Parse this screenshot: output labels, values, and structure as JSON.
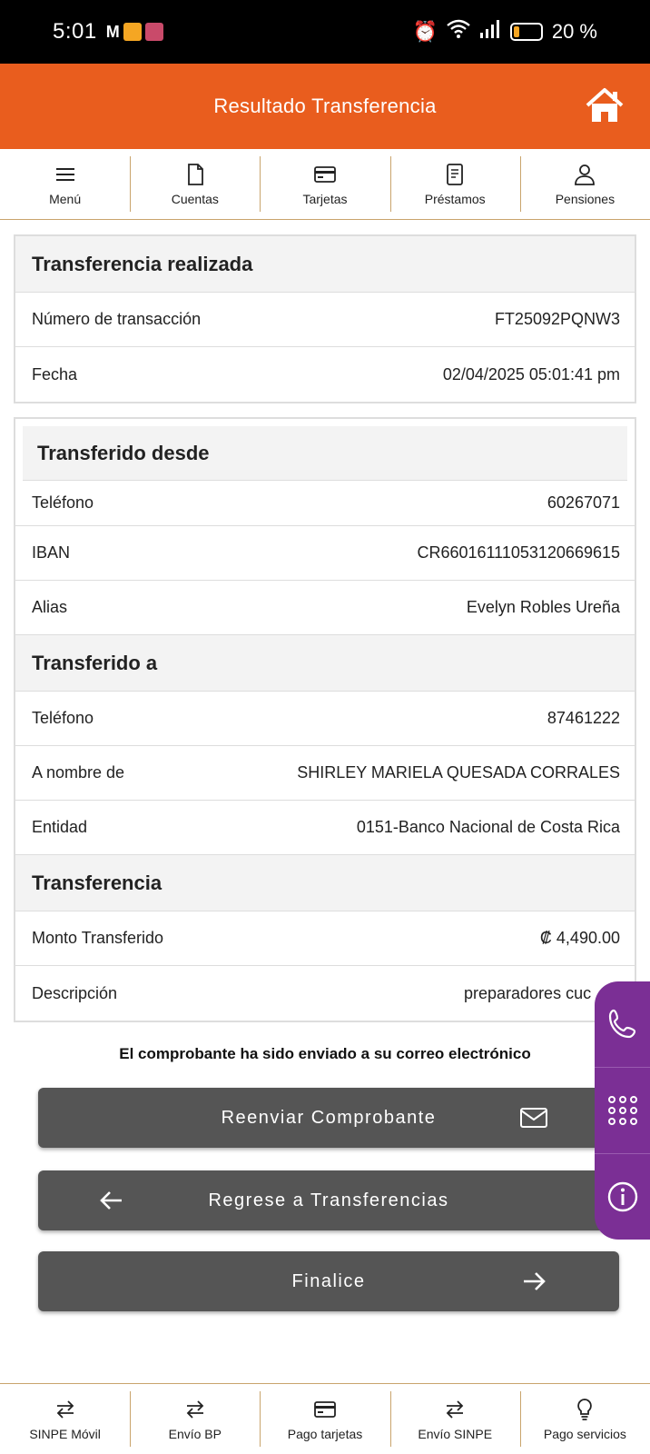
{
  "status_bar": {
    "time": "5:01",
    "battery": "20 %"
  },
  "header": {
    "title": "Resultado Transferencia"
  },
  "top_nav": [
    {
      "label": "Menú",
      "icon": "menu-icon"
    },
    {
      "label": "Cuentas",
      "icon": "document-icon"
    },
    {
      "label": "Tarjetas",
      "icon": "card-icon"
    },
    {
      "label": "Préstamos",
      "icon": "receipt-icon"
    },
    {
      "label": "Pensiones",
      "icon": "person-icon"
    }
  ],
  "summary": {
    "title": "Transferencia realizada",
    "rows": [
      {
        "label": "Número de transacción",
        "value": "FT25092PQNW3"
      },
      {
        "label": "Fecha",
        "value": "02/04/2025 05:01:41 pm"
      }
    ]
  },
  "from": {
    "title": "Transferido desde",
    "rows": [
      {
        "label": "Teléfono",
        "value": "60267071"
      },
      {
        "label": "IBAN",
        "value": "CR66016111053120669615"
      },
      {
        "label": "Alias",
        "value": "Evelyn Robles Ureña"
      }
    ]
  },
  "to": {
    "title": "Transferido a",
    "rows": [
      {
        "label": "Teléfono",
        "value": "87461222"
      },
      {
        "label": "A nombre de",
        "value": "SHIRLEY MARIELA QUESADA CORRALES"
      },
      {
        "label": "Entidad",
        "value": "0151-Banco Nacional de Costa Rica"
      }
    ]
  },
  "transfer": {
    "title": "Transferencia",
    "rows": [
      {
        "label": "Monto Transferido",
        "value": "₡  4,490.00"
      },
      {
        "label": "Descripción",
        "value": "preparadores cuc"
      }
    ]
  },
  "notice": "El comprobante ha sido enviado a su correo electrónico",
  "buttons": {
    "resend": "Reenviar Comprobante",
    "back": "Regrese a Transferencias",
    "finish": "Finalice"
  },
  "bottom_nav": [
    {
      "label": "SINPE Móvil",
      "icon": "swap-icon"
    },
    {
      "label": "Envío BP",
      "icon": "swap-icon"
    },
    {
      "label": "Pago tarjetas",
      "icon": "card-icon"
    },
    {
      "label": "Envío SINPE",
      "icon": "swap-icon"
    },
    {
      "label": "Pago servicios",
      "icon": "lightbulb-icon"
    }
  ],
  "colors": {
    "brand_orange": "#e95d1e",
    "button_gray": "#555555",
    "fab_purple": "#7b2f95",
    "divider_gold": "#c9a46c"
  }
}
